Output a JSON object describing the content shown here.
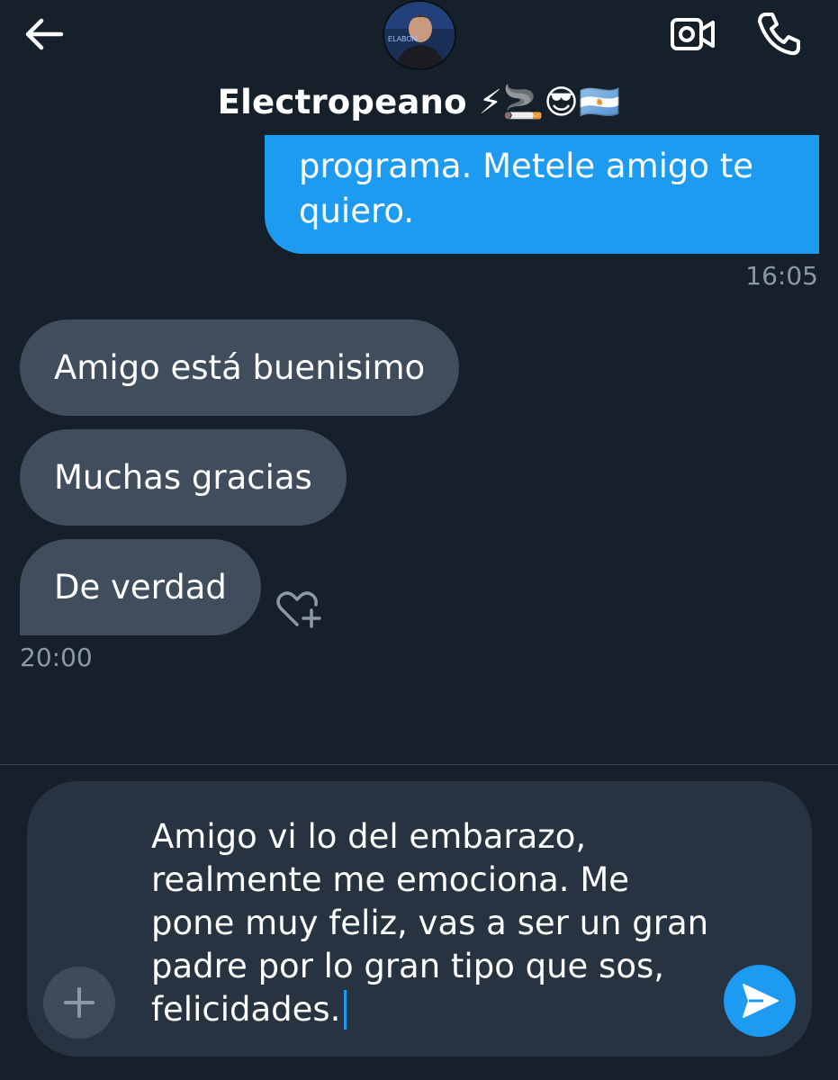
{
  "header": {
    "contact_name": "Electropeano",
    "contact_emojis": "⚡🚬😎🇦🇷",
    "avatar_caption": "ELABON"
  },
  "messages": {
    "outgoing": {
      "text": "programa. Metele amigo te quiero.",
      "time": "16:05"
    },
    "incoming": [
      {
        "text": "Amigo está buenisimo"
      },
      {
        "text": "Muchas gracias"
      },
      {
        "text": "De verdad"
      }
    ],
    "incoming_time": "20:00"
  },
  "composer": {
    "text": "Amigo vi lo del embarazo, realmente me emociona. Me pone muy feliz, vas a ser un gran padre por lo gran tipo que sos, felicidades."
  },
  "colors": {
    "background": "#15202b",
    "accent": "#1d9bf0",
    "incoming_bubble": "#3f4d5c",
    "muted_text": "#8b98a5"
  },
  "icons": {
    "back": "arrow-left-icon",
    "video": "video-call-icon",
    "call": "phone-icon",
    "react": "heart-plus-icon",
    "add": "plus-icon",
    "send": "send-icon"
  }
}
